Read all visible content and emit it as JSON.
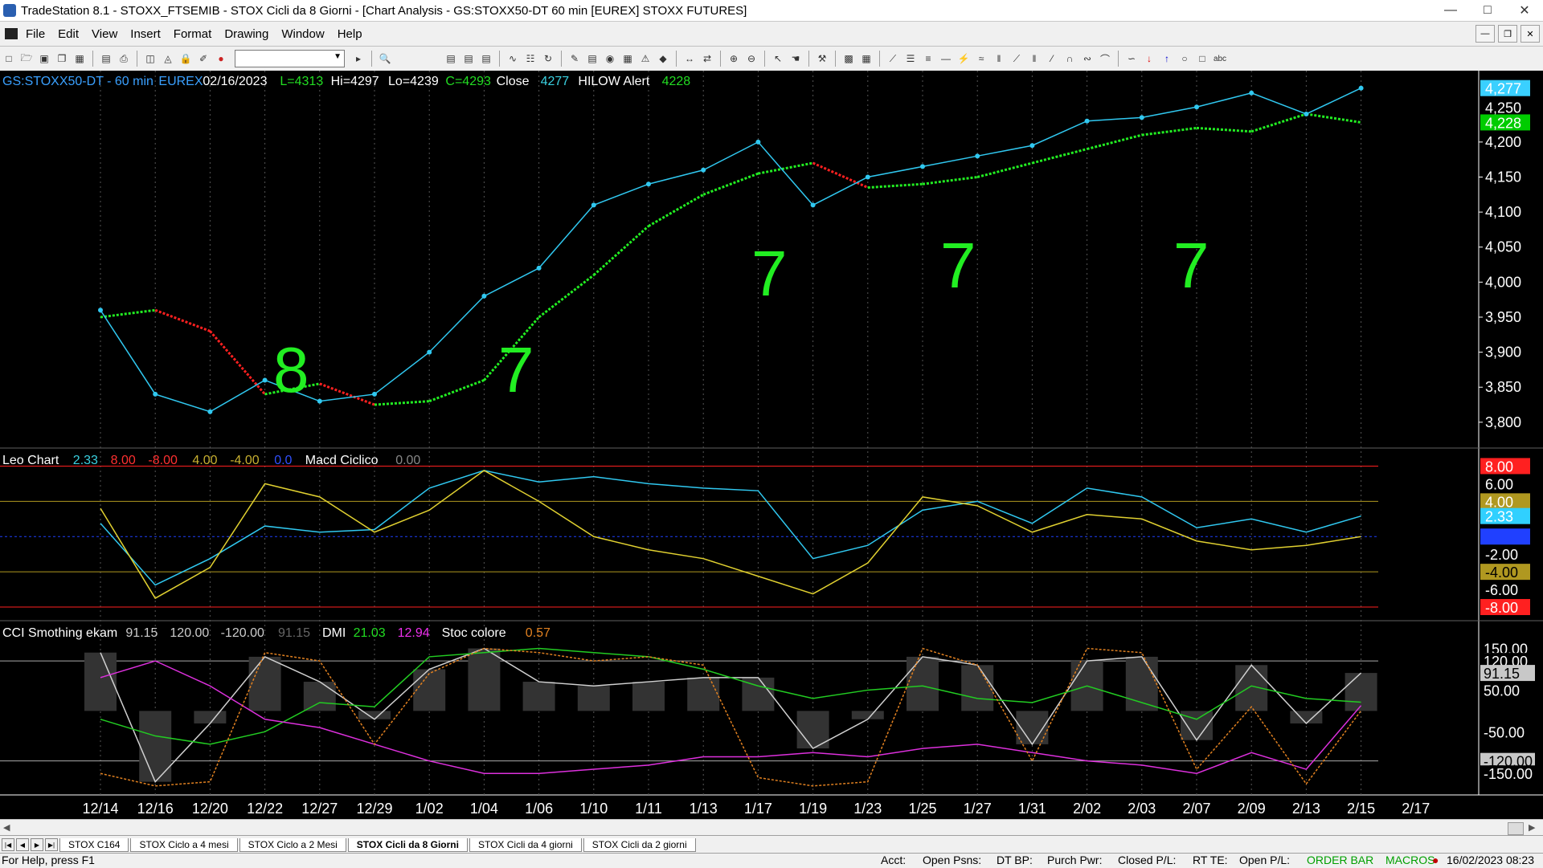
{
  "window": {
    "title": "TradeStation 8.1 - STOXX_FTSEMIB - STOX Cicli da 8 Giorni - [Chart Analysis - GS:STOXX50-DT  60 min  [EUREX] STOXX FUTURES]"
  },
  "menu": [
    "File",
    "Edit",
    "View",
    "Insert",
    "Format",
    "Drawing",
    "Window",
    "Help"
  ],
  "price_header": [
    {
      "text": "GS:STOXX50-DT - 60 min",
      "color": "#3aa0ff"
    },
    {
      "text": "EUREX",
      "color": "#3aa0ff"
    },
    {
      "text": "02/16/2023",
      "color": "#ffffff"
    },
    {
      "text": "L=4313",
      "color": "#22dd22"
    },
    {
      "text": "Hi=4297",
      "color": "#ffffff"
    },
    {
      "text": "Lo=4239",
      "color": "#ffffff"
    },
    {
      "text": "C=4293",
      "color": "#22dd22"
    },
    {
      "text": "Close",
      "color": "#ffffff"
    },
    {
      "text": "4277",
      "color": "#3ad0e0"
    },
    {
      "text": "HILOW Alert",
      "color": "#ffffff"
    },
    {
      "text": "4228",
      "color": "#22dd22"
    }
  ],
  "osc_header": [
    {
      "text": "Leo Chart",
      "color": "#ffffff"
    },
    {
      "text": "2.33",
      "color": "#3ad0e0"
    },
    {
      "text": "8.00",
      "color": "#ff3030"
    },
    {
      "text": "-8.00",
      "color": "#ff3030"
    },
    {
      "text": "4.00",
      "color": "#c8b030"
    },
    {
      "text": "-4.00",
      "color": "#c8b030"
    },
    {
      "text": "0.0",
      "color": "#3050ff"
    },
    {
      "text": "Macd Ciclico",
      "color": "#ffffff"
    },
    {
      "text": "0.00",
      "color": "#888888"
    }
  ],
  "cci_header": [
    {
      "text": "CCI Smothing ekam",
      "color": "#ffffff"
    },
    {
      "text": "91.15",
      "color": "#cccccc"
    },
    {
      "text": "120.00",
      "color": "#cccccc"
    },
    {
      "text": "-120.00",
      "color": "#cccccc"
    },
    {
      "text": "91.15",
      "color": "#666666"
    },
    {
      "text": "DMI",
      "color": "#ffffff"
    },
    {
      "text": "21.03",
      "color": "#22dd22"
    },
    {
      "text": "12.94",
      "color": "#ee30ee"
    },
    {
      "text": "Stoc colore",
      "color": "#ffffff"
    },
    {
      "text": "0.57",
      "color": "#e08020"
    }
  ],
  "price_axis": {
    "ticks": [
      "4,200",
      "4,150",
      "4,100",
      "4,050",
      "4,000",
      "3,950",
      "3,900",
      "3,850",
      "3,800"
    ],
    "tick_values": [
      4200,
      4150,
      4100,
      4050,
      4000,
      3950,
      3900,
      3850,
      3800
    ],
    "min": 3770,
    "max": 4295,
    "badges": [
      {
        "text": "4,277",
        "value": 4277,
        "bg": "#3ad0ff",
        "fg": "#ffffff"
      },
      {
        "text": "4,250",
        "value": 4250,
        "bg": "#000000",
        "fg": "#ffffff"
      },
      {
        "text": "4,228",
        "value": 4228,
        "bg": "#00cc00",
        "fg": "#ffffff"
      }
    ]
  },
  "osc_axis": {
    "min": -9,
    "max": 9.5,
    "labels": [
      {
        "text": "8.00",
        "value": 8,
        "bg": "#ff2020",
        "fg": "#ffffff"
      },
      {
        "text": "6.00",
        "value": 6,
        "bg": "#000000",
        "fg": "#ffffff"
      },
      {
        "text": "4.00",
        "value": 4,
        "bg": "#b09820",
        "fg": "#ffffff"
      },
      {
        "text": "2.33",
        "value": 2.33,
        "bg": "#30d0ff",
        "fg": "#ffffff"
      },
      {
        "text": "0.00",
        "value": 0,
        "bg": "#2040ff",
        "fg": "#2040ff"
      },
      {
        "text": "-2.00",
        "value": -2,
        "bg": "#000000",
        "fg": "#ffffff"
      },
      {
        "text": "-4.00",
        "value": -4,
        "bg": "#b09820",
        "fg": "#000000"
      },
      {
        "text": "-6.00",
        "value": -6,
        "bg": "#000000",
        "fg": "#ffffff"
      },
      {
        "text": "-8.00",
        "value": -8,
        "bg": "#ff2020",
        "fg": "#ffffff"
      }
    ]
  },
  "cci_axis": {
    "min": -190,
    "max": 205,
    "labels": [
      {
        "text": "150.00",
        "value": 150,
        "bg": "#000000",
        "fg": "#ffffff"
      },
      {
        "text": "120.00",
        "value": 120,
        "bg": "#000000",
        "fg": "#ffffff"
      },
      {
        "text": "91.15",
        "value": 91.15,
        "bg": "#c8c8c8",
        "fg": "#000000"
      },
      {
        "text": "50.00",
        "value": 50,
        "bg": "#000000",
        "fg": "#ffffff"
      },
      {
        "text": "-50.00",
        "value": -50,
        "bg": "#000000",
        "fg": "#ffffff"
      },
      {
        "text": "-120.00",
        "value": -120,
        "bg": "#c8c8c8",
        "fg": "#000000"
      },
      {
        "text": "-150.00",
        "value": -150,
        "bg": "#000000",
        "fg": "#ffffff"
      }
    ]
  },
  "time_axis": [
    "12/14",
    "12/16",
    "12/20",
    "12/22",
    "12/27",
    "12/29",
    "1/02",
    "1/04",
    "1/06",
    "1/10",
    "1/11",
    "1/13",
    "1/17",
    "1/19",
    "1/23",
    "1/25",
    "1/27",
    "1/31",
    "2/02",
    "2/03",
    "2/07",
    "2/09",
    "2/13",
    "2/15",
    "2/17"
  ],
  "annotations": [
    "8",
    "7",
    "7",
    "7",
    "7"
  ],
  "chart_data": {
    "type": "line",
    "x": [
      "12/14",
      "12/16",
      "12/20",
      "12/22",
      "12/27",
      "12/29",
      "1/02",
      "1/04",
      "1/06",
      "1/10",
      "1/11",
      "1/13",
      "1/17",
      "1/19",
      "1/23",
      "1/25",
      "1/27",
      "1/31",
      "2/02",
      "2/03",
      "2/07",
      "2/09",
      "2/13",
      "2/15"
    ],
    "price_close": [
      3960,
      3840,
      3815,
      3860,
      3830,
      3840,
      3900,
      3980,
      4020,
      4110,
      4140,
      4160,
      4200,
      4110,
      4150,
      4165,
      4180,
      4195,
      4230,
      4235,
      4250,
      4270,
      4240,
      4277
    ],
    "hilow_alert": [
      3950,
      3960,
      3930,
      3840,
      3855,
      3825,
      3830,
      3860,
      3950,
      4010,
      4080,
      4125,
      4155,
      4170,
      4135,
      4140,
      4150,
      4170,
      4190,
      4210,
      4220,
      4215,
      4240,
      4228
    ],
    "leo_chart": [
      1.5,
      -5.5,
      -2.5,
      1.2,
      0.5,
      0.8,
      5.5,
      7.5,
      6.2,
      6.8,
      6.0,
      5.5,
      5.2,
      -2.5,
      -1.0,
      3.0,
      4.0,
      1.5,
      5.5,
      4.5,
      1.0,
      2.0,
      0.5,
      2.33
    ],
    "macd_ciclico": [
      3.2,
      -7.0,
      -3.5,
      6.0,
      4.5,
      0.5,
      3.0,
      7.5,
      4.0,
      0.0,
      -1.5,
      -2.5,
      -4.5,
      -6.5,
      -3.0,
      4.5,
      3.5,
      0.5,
      2.5,
      2.0,
      -0.5,
      -1.5,
      -1.0,
      0.0
    ],
    "cci": [
      140,
      -170,
      -30,
      130,
      70,
      -20,
      100,
      150,
      70,
      60,
      70,
      80,
      80,
      -90,
      -20,
      130,
      110,
      -80,
      120,
      130,
      -70,
      110,
      -30,
      91.15
    ],
    "dmi_plus": [
      -20,
      -60,
      -80,
      -50,
      20,
      10,
      130,
      140,
      150,
      140,
      130,
      100,
      60,
      30,
      50,
      60,
      30,
      20,
      60,
      20,
      -20,
      60,
      30,
      21.03
    ],
    "dmi_minus": [
      80,
      120,
      60,
      -20,
      -40,
      -80,
      -120,
      -150,
      -150,
      -140,
      -130,
      -110,
      -110,
      -100,
      -110,
      -90,
      -80,
      -100,
      -120,
      -130,
      -150,
      -100,
      -140,
      12.94
    ],
    "stoc_colore": [
      -150,
      -180,
      -170,
      140,
      120,
      -80,
      90,
      150,
      140,
      120,
      130,
      110,
      -160,
      -180,
      -170,
      150,
      110,
      -120,
      150,
      140,
      -140,
      10,
      -175,
      0.57
    ]
  }
}
